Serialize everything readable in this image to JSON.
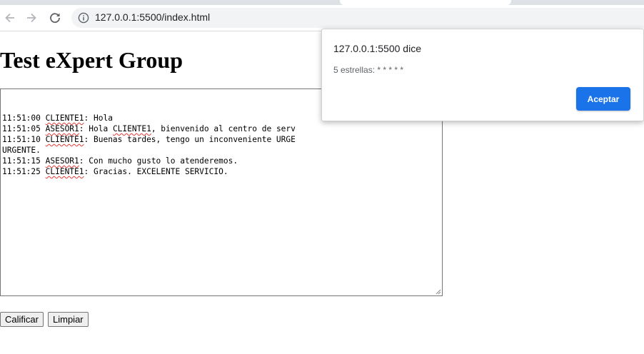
{
  "browser": {
    "url": "127.0.0.1:5500/index.html",
    "icons": [
      "back-icon",
      "forward-icon",
      "reload-icon",
      "info-icon"
    ]
  },
  "page": {
    "title": "Test eXpert Group",
    "chat_lines": [
      {
        "parts": [
          {
            "t": "11:51:00 "
          },
          {
            "t": "CLIENTE1",
            "spell": true
          },
          {
            "t": ": Hola"
          }
        ]
      },
      {
        "parts": [
          {
            "t": "11:51:05 "
          },
          {
            "t": "ASESOR1",
            "spell": true
          },
          {
            "t": ": Hola "
          },
          {
            "t": "CLIENTE1",
            "spell": true
          },
          {
            "t": ", bienvenido al centro de serv"
          }
        ]
      },
      {
        "parts": [
          {
            "t": "11:51:10 "
          },
          {
            "t": "CLIENTE1",
            "spell": true
          },
          {
            "t": ": Buenas tardes, tengo un inconveniente URGE"
          }
        ]
      },
      {
        "parts": [
          {
            "t": "URGENTE."
          }
        ]
      },
      {
        "parts": [
          {
            "t": "11:51:15 "
          },
          {
            "t": "ASESOR1",
            "spell": true
          },
          {
            "t": ": Con mucho gusto lo atenderemos."
          }
        ]
      },
      {
        "parts": [
          {
            "t": "11:51:25 "
          },
          {
            "t": "CLIENTE1",
            "spell": true
          },
          {
            "t": ": Gracias. EXCELENTE SERVICIO."
          }
        ]
      }
    ],
    "buttons": {
      "rate": "Calificar",
      "clear": "Limpiar"
    }
  },
  "dialog": {
    "title": "127.0.0.1:5500 dice",
    "message": "5 estrellas: * * * * *",
    "ok_label": "Aceptar"
  },
  "colors": {
    "accent": "#1a73e8",
    "spellcheck": "#e53935"
  }
}
